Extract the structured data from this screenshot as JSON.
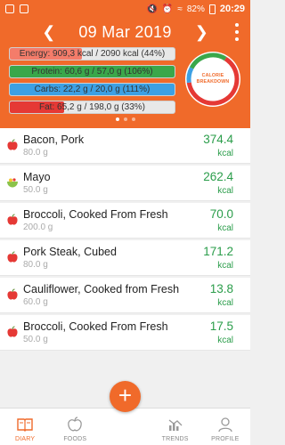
{
  "status_bar": {
    "battery": "82%",
    "time": "20:29"
  },
  "header": {
    "date": "09 Mar 2019",
    "bars": [
      {
        "label": "Energy: 909,3 kcal  /  2090 kcal (44%)",
        "fill_fraction": 0.44,
        "color": "#f47c6a"
      },
      {
        "label": "Protein: 60,6 g  /  57,0 g (106%)",
        "fill_fraction": 1.0,
        "color": "#3aa74a"
      },
      {
        "label": "Carbs: 22,2 g  /  20,0 g (111%)",
        "fill_fraction": 1.0,
        "color": "#3da0e3"
      },
      {
        "label": "Fat: 65,2 g  /  198,0 g (33%)",
        "fill_fraction": 0.33,
        "color": "#e53935"
      }
    ],
    "breakdown": {
      "line1": "CALORIE",
      "line2": "BREAKDOWN",
      "segments": [
        {
          "name": "fat",
          "fraction": 0.64,
          "color": "#e53935"
        },
        {
          "name": "carbs",
          "fraction": 0.1,
          "color": "#3da0e3"
        },
        {
          "name": "protein",
          "fraction": 0.26,
          "color": "#3aa74a"
        }
      ]
    },
    "pages": 3,
    "active_page": 0
  },
  "entries": [
    {
      "name": "Bacon, Pork",
      "qty": "80.0 g",
      "kcal": "374.4",
      "unit": "kcal",
      "icon": "apple-icon"
    },
    {
      "name": "Mayo",
      "qty": "50.0 g",
      "kcal": "262.4",
      "unit": "kcal",
      "icon": "bowl-icon"
    },
    {
      "name": "Broccoli, Cooked From Fresh",
      "qty": "200.0 g",
      "kcal": "70.0",
      "unit": "kcal",
      "icon": "apple-icon"
    },
    {
      "name": "Pork Steak, Cubed",
      "qty": "80.0 g",
      "kcal": "171.2",
      "unit": "kcal",
      "icon": "apple-icon"
    },
    {
      "name": "Cauliflower, Cooked from Fresh",
      "qty": "60.0 g",
      "kcal": "13.8",
      "unit": "kcal",
      "icon": "apple-icon"
    },
    {
      "name": "Broccoli, Cooked From Fresh",
      "qty": "50.0 g",
      "kcal": "17.5",
      "unit": "kcal",
      "icon": "apple-icon"
    }
  ],
  "nav": {
    "diary": "DIARY",
    "foods": "FOODS",
    "add": "+",
    "trends": "TRENDS",
    "profile": "PROFILE"
  },
  "colors": {
    "accent": "#f06a2a",
    "kcal_green": "#2a9d4a"
  }
}
